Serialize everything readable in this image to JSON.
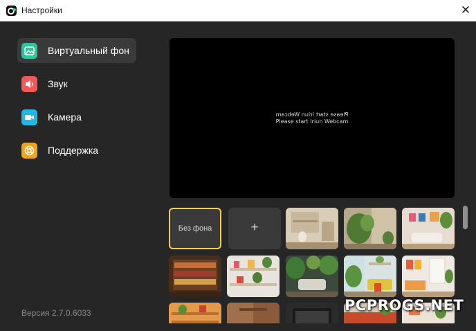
{
  "window": {
    "title": "Настройки",
    "close_glyph": "✕"
  },
  "sidebar": {
    "items": [
      {
        "label": "Виртуальный фон",
        "icon": "image-icon",
        "color": "#2fc59b",
        "active": true
      },
      {
        "label": "Звук",
        "icon": "speaker-icon",
        "color": "#f05a5a",
        "active": false
      },
      {
        "label": "Камера",
        "icon": "camera-icon",
        "color": "#22b8e3",
        "active": false
      },
      {
        "label": "Поддержка",
        "icon": "lifebuoy-icon",
        "color": "#f2a51a",
        "active": false
      }
    ],
    "version": "Версия 2.7.0.6033"
  },
  "preview": {
    "line_mirrored": "Please start Iriun Webcam",
    "line": "Please start Iriun Webcam"
  },
  "backgrounds": {
    "none_label": "Без фона",
    "add_label": "+",
    "selected": "none"
  },
  "watermark": "PCPROGS.NET",
  "colors": {
    "accent_selected": "#f2cf55",
    "app_bg": "#262626",
    "tile_bg": "#3a3a3a"
  }
}
